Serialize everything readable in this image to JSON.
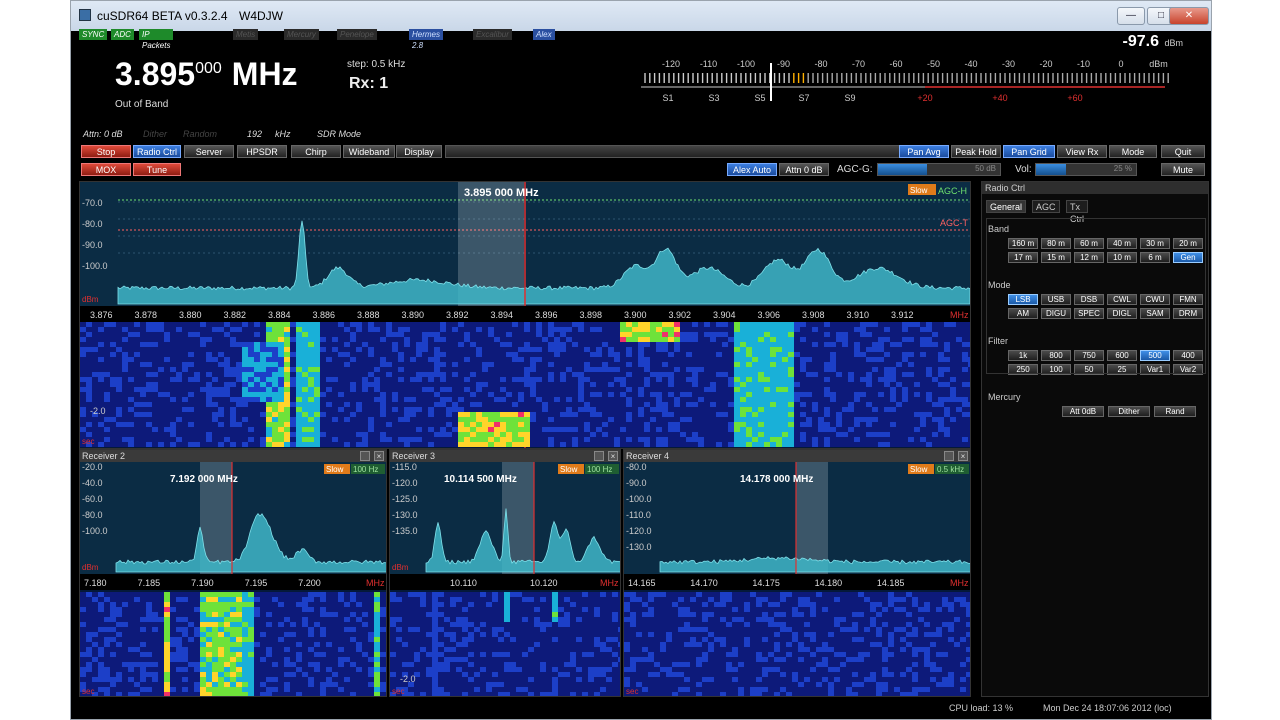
{
  "window": {
    "title": "cuSDR64 BETA   v0.3.2.4",
    "callsign": "W4DJW",
    "minimize": "—",
    "maximize": "□",
    "close": "✕"
  },
  "status_flags": [
    "SYNC",
    "ADC",
    "IP Packets",
    "Metis",
    "Mercury",
    "Penelope",
    "Hermes 2.8",
    "Excalibur",
    "Alex"
  ],
  "header": {
    "freq_main": "3.895",
    "freq_sub": "000",
    "freq_unit": "MHz",
    "band_status": "Out of Band",
    "step": "step: 0.5 kHz",
    "rx": "Rx: 1",
    "attn": "Attn: 0 dB",
    "dither": "Dither",
    "random": "Random",
    "sample_rate": "192",
    "sample_unit": "kHz",
    "sdr_mode": "SDR Mode",
    "meter_value": "-97.6",
    "meter_unit": "dBm",
    "meter_scale": [
      "-120",
      "-110",
      "-100",
      "-90",
      "-80",
      "-70",
      "-60",
      "-50",
      "-40",
      "-30",
      "-20",
      "-10",
      "0",
      "dBm"
    ],
    "s_scale": [
      "S1",
      "S3",
      "S5",
      "S7",
      "S9",
      "+20",
      "+40",
      "+60"
    ]
  },
  "toolbar": {
    "left": [
      "Stop",
      "Radio Ctrl",
      "Server",
      "HPSDR",
      "Chirp",
      "Wideband",
      "Display"
    ],
    "right": [
      "Pan Avg",
      "Peak Hold",
      "Pan Grid",
      "View Rx",
      "Mode",
      "Quit"
    ],
    "mox": "MOX",
    "tune": "Tune",
    "alex_auto": "Alex Auto",
    "attn_btn": "Attn 0 dB",
    "agc_g": "AGC-G:",
    "agc_val": "50 dB",
    "vol": "Vol:",
    "vol_val": "25 %",
    "mute": "Mute"
  },
  "main_panel": {
    "freq_main": "3.895",
    "freq_sub": "000",
    "freq_unit": "MHz",
    "db_labels": [
      "-70.0",
      "-80.0",
      "-90.0",
      "-100.0"
    ],
    "dbm": "dBm",
    "x_ticks": [
      "3.876",
      "3.878",
      "3.880",
      "3.882",
      "3.884",
      "3.886",
      "3.888",
      "3.890",
      "3.892",
      "3.894",
      "3.896",
      "3.898",
      "3.900",
      "3.902",
      "3.904",
      "3.906",
      "3.908",
      "3.910",
      "3.912"
    ],
    "mhz": "MHz",
    "slow": "Slow",
    "agc_h": "AGC-H",
    "agc_t": "AGC-T",
    "wf_label": "-2.0",
    "sec": "sec"
  },
  "receivers": [
    {
      "title": "Receiver 2",
      "freq_main": "7.192",
      "freq_sub": "000",
      "mhz": "MHz",
      "slow": "Slow",
      "bw": "100 Hz",
      "db": [
        "-20.0",
        "-40.0",
        "-60.0",
        "-80.0",
        "-100.0"
      ],
      "dbm": "dBm",
      "ticks": [
        "7.180",
        "7.185",
        "7.190",
        "7.195",
        "7.200"
      ],
      "sec": "sec",
      "wf_label": ""
    },
    {
      "title": "Receiver 3",
      "freq_main": "10.114",
      "freq_sub": "500",
      "mhz": "MHz",
      "slow": "Slow",
      "bw": "100 Hz",
      "db": [
        "-115.0",
        "-120.0",
        "-125.0",
        "-130.0",
        "-135.0"
      ],
      "dbm": "dBm",
      "ticks": [
        "10.110",
        "10.120"
      ],
      "sec": "sec",
      "wf_label": "-2.0"
    },
    {
      "title": "Receiver 4",
      "freq_main": "14.178",
      "freq_sub": "000",
      "mhz": "MHz",
      "slow": "Slow",
      "bw": "0.5 kHz",
      "db": [
        "-80.0",
        "-90.0",
        "-100.0",
        "-110.0",
        "-120.0",
        "-130.0"
      ],
      "dbm": "",
      "ticks": [
        "14.165",
        "14.170",
        "14.175",
        "14.180",
        "14.185"
      ],
      "sec": "sec",
      "wf_label": ""
    }
  ],
  "radio_ctrl": {
    "title": "Radio Ctrl",
    "tabs": [
      "General",
      "AGC",
      "Tx Ctrl"
    ],
    "band_label": "Band",
    "band": [
      "160 m",
      "80 m",
      "60 m",
      "40 m",
      "30 m",
      "20 m",
      "17 m",
      "15 m",
      "12 m",
      "10 m",
      "6 m",
      "Gen"
    ],
    "mode_label": "Mode",
    "mode": [
      "LSB",
      "USB",
      "DSB",
      "CWL",
      "CWU",
      "FMN",
      "AM",
      "DIGU",
      "SPEC",
      "DIGL",
      "SAM",
      "DRM"
    ],
    "filter_label": "Filter",
    "filter": [
      "1k",
      "800",
      "750",
      "600",
      "500",
      "400",
      "250",
      "100",
      "50",
      "25",
      "Var1",
      "Var2"
    ],
    "mercury_label": "Mercury",
    "mercury": [
      "Att 0dB",
      "Dither",
      "Rand"
    ]
  },
  "footer": {
    "cpu": "CPU load: 13 %",
    "date": "Mon Dec 24 18:07:06 2012 (loc)"
  },
  "colors": {
    "accent": "#3b7ee0",
    "stop": "#e04a3a",
    "spectrum": "#3fb6c8",
    "marker": "#e03030"
  }
}
